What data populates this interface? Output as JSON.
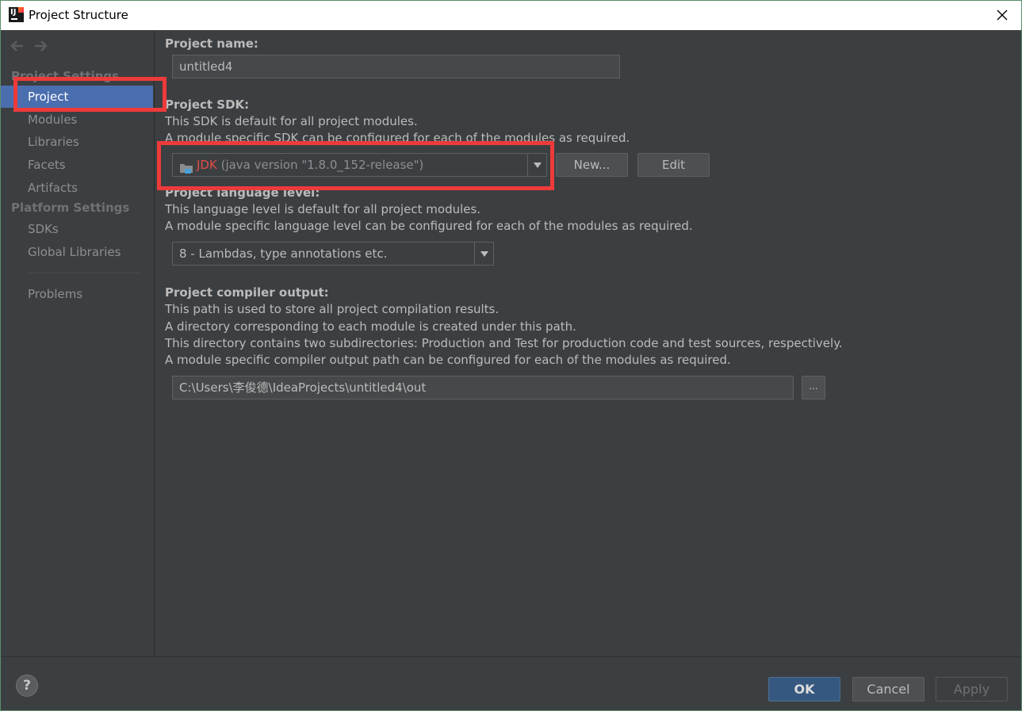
{
  "window": {
    "title": "Project Structure",
    "app_icon_letters": "IJ"
  },
  "sidebar": {
    "section_project_settings": "Project Settings",
    "section_platform_settings": "Platform Settings",
    "items": {
      "project": "Project",
      "modules": "Modules",
      "libraries": "Libraries",
      "facets": "Facets",
      "artifacts": "Artifacts",
      "sdks": "SDKs",
      "global_libraries": "Global Libraries",
      "problems": "Problems"
    },
    "selected": "Project",
    "help_label": "?"
  },
  "main": {
    "project_name": {
      "label": "Project name:",
      "value": "untitled4"
    },
    "project_sdk": {
      "label": "Project SDK:",
      "desc1": "This SDK is default for all project modules.",
      "desc2": "A module specific SDK can be configured for each of the modules as required.",
      "sdk_name": "JDK",
      "sdk_version": "(java version \"1.8.0_152-release\")",
      "new_button": "New...",
      "edit_button": "Edit"
    },
    "language_level": {
      "label": "Project language level:",
      "desc1": "This language level is default for all project modules.",
      "desc2": "A module specific language level can be configured for each of the modules as required.",
      "value": "8 - Lambdas, type annotations etc."
    },
    "compiler_output": {
      "label": "Project compiler output:",
      "desc1": "This path is used to store all project compilation results.",
      "desc2": "A directory corresponding to each module is created under this path.",
      "desc3": "This directory contains two subdirectories: Production and Test for production code and test sources, respectively.",
      "desc4": "A module specific compiler output path can be configured for each of the modules as required.",
      "path": "C:\\Users\\李俊德\\IdeaProjects\\untitled4\\out",
      "browse_button": "..."
    }
  },
  "footer": {
    "ok": "OK",
    "cancel": "Cancel",
    "apply": "Apply"
  },
  "colors": {
    "background": "#3c3f41",
    "selection": "#4b6eaf",
    "annotation": "#ee3a3a",
    "sdk_name": "#e44c4c",
    "ok_button": "#365880"
  }
}
